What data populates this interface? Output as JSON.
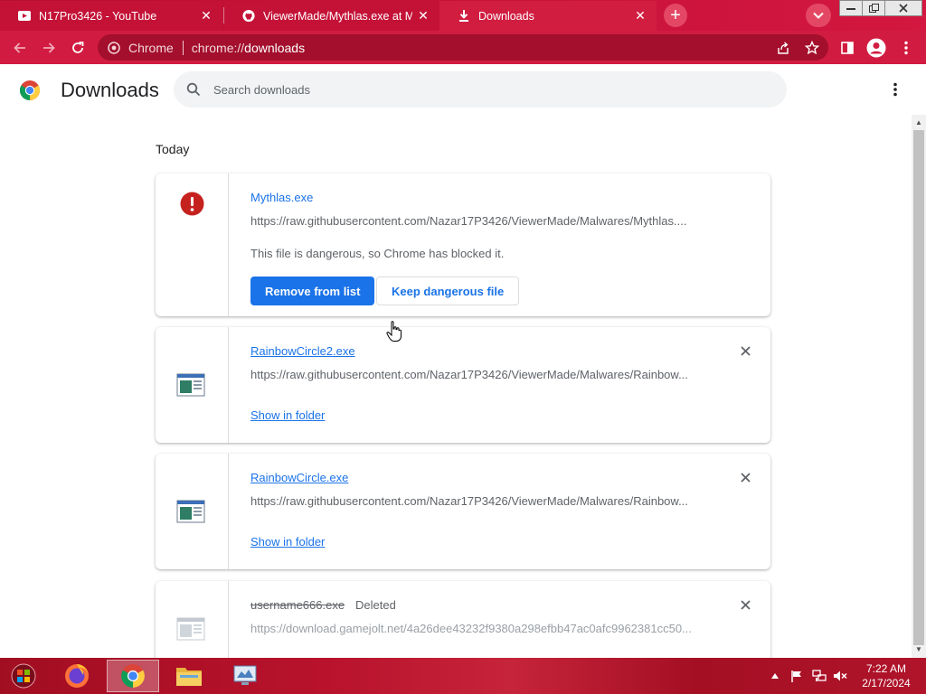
{
  "browser": {
    "tabs": [
      {
        "title": "N17Pro3426 - YouTube",
        "active": false,
        "icon": "youtube-icon"
      },
      {
        "title": "ViewerMade/Mythlas.exe at Mal",
        "active": false,
        "icon": "github-icon"
      },
      {
        "title": "Downloads",
        "active": true,
        "icon": "download-icon"
      }
    ],
    "omnibox": {
      "site_chip": "Chrome",
      "url_scheme": "chrome://",
      "url_host": "downloads"
    }
  },
  "downloads_page": {
    "title": "Downloads",
    "search_placeholder": "Search downloads",
    "section_label": "Today",
    "items": [
      {
        "filename": "Mythlas.exe",
        "url": "https://raw.githubusercontent.com/Nazar17P3426/ViewerMade/Malwares/Mythlas....",
        "warning": "This file is dangerous, so Chrome has blocked it.",
        "primary_action": "Remove from list",
        "secondary_action": "Keep dangerous file",
        "icon": "danger-icon"
      },
      {
        "filename": "RainbowCircle2.exe",
        "url": "https://raw.githubusercontent.com/Nazar17P3426/ViewerMade/Malwares/Rainbow...",
        "action": "Show in folder",
        "icon": "executable-file-icon"
      },
      {
        "filename": "RainbowCircle.exe",
        "url": "https://raw.githubusercontent.com/Nazar17P3426/ViewerMade/Malwares/Rainbow...",
        "action": "Show in folder",
        "icon": "executable-file-icon"
      },
      {
        "filename": "username666.exe",
        "status": "Deleted",
        "url": "https://download.gamejolt.net/4a26dee43232f9380a298efbb47ac0afc9962381cc50...",
        "icon": "executable-file-icon"
      }
    ]
  },
  "taskbar": {
    "clock_time": "7:22 AM",
    "clock_date": "2/17/2024",
    "items": [
      "start-orb",
      "firefox",
      "chrome",
      "file-explorer",
      "control-panel"
    ]
  },
  "colors": {
    "theme_red": "#d21b40",
    "link_blue": "#1a73e8",
    "danger_red": "#c5221f"
  }
}
